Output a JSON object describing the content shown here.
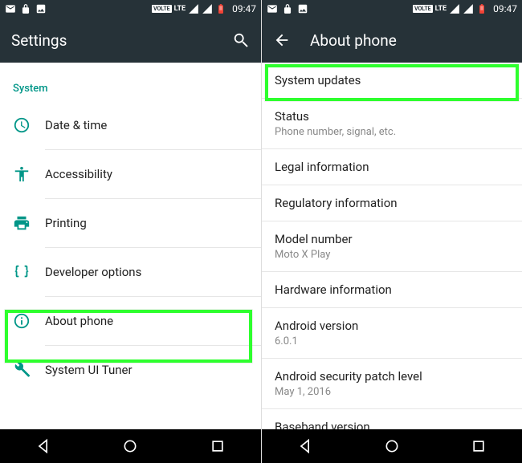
{
  "status": {
    "volte": "VOLTE",
    "lte": "LTE",
    "time": "09:47"
  },
  "left": {
    "title": "Settings",
    "section": "System",
    "items": [
      {
        "label": "Date & time"
      },
      {
        "label": "Accessibility"
      },
      {
        "label": "Printing"
      },
      {
        "label": "Developer options"
      },
      {
        "label": "About phone"
      },
      {
        "label": "System UI Tuner"
      }
    ]
  },
  "right": {
    "title": "About phone",
    "items": [
      {
        "label": "System updates"
      },
      {
        "label": "Status",
        "sub": "Phone number, signal, etc."
      },
      {
        "label": "Legal information"
      },
      {
        "label": "Regulatory information"
      },
      {
        "label": "Model number",
        "sub": "Moto X Play"
      },
      {
        "label": "Hardware information"
      },
      {
        "label": "Android version",
        "sub": "6.0.1"
      },
      {
        "label": "Android security patch level",
        "sub": "May 1, 2016"
      },
      {
        "label": "Baseband version"
      }
    ]
  }
}
